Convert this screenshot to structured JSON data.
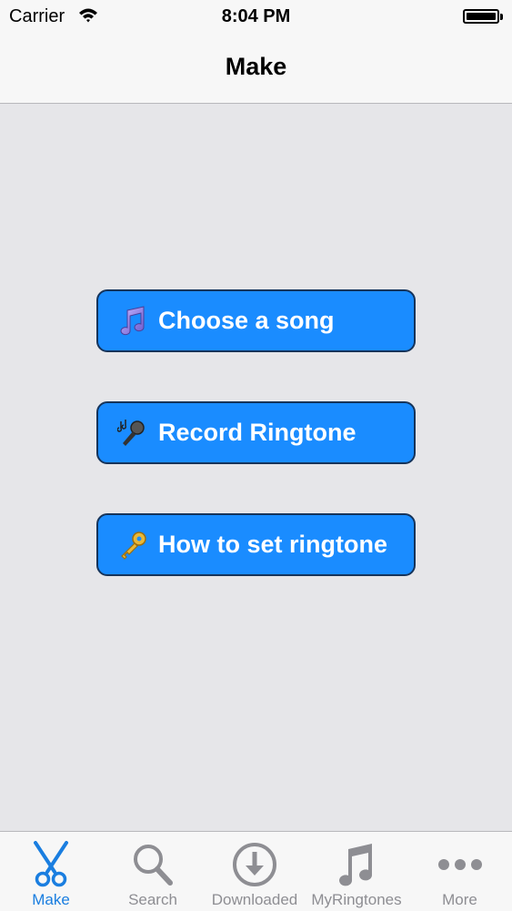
{
  "status_bar": {
    "carrier": "Carrier",
    "time": "8:04 PM"
  },
  "nav": {
    "title": "Make"
  },
  "buttons": [
    {
      "label": "Choose a song",
      "icon": "musical-note-icon"
    },
    {
      "label": "Record Ringtone",
      "icon": "microphone-icon"
    },
    {
      "label": "How to set ringtone",
      "icon": "key-icon"
    }
  ],
  "tabs": [
    {
      "label": "Make",
      "icon": "scissors-icon",
      "active": true
    },
    {
      "label": "Search",
      "icon": "search-icon",
      "active": false
    },
    {
      "label": "Downloaded",
      "icon": "download-icon",
      "active": false
    },
    {
      "label": "MyRingtones",
      "icon": "music-note-icon",
      "active": false
    },
    {
      "label": "More",
      "icon": "more-icon",
      "active": false
    }
  ],
  "colors": {
    "accent": "#1a7ee0",
    "button": "#1a8cff",
    "background": "#e6e6e9",
    "inactive": "#8e8e93"
  }
}
